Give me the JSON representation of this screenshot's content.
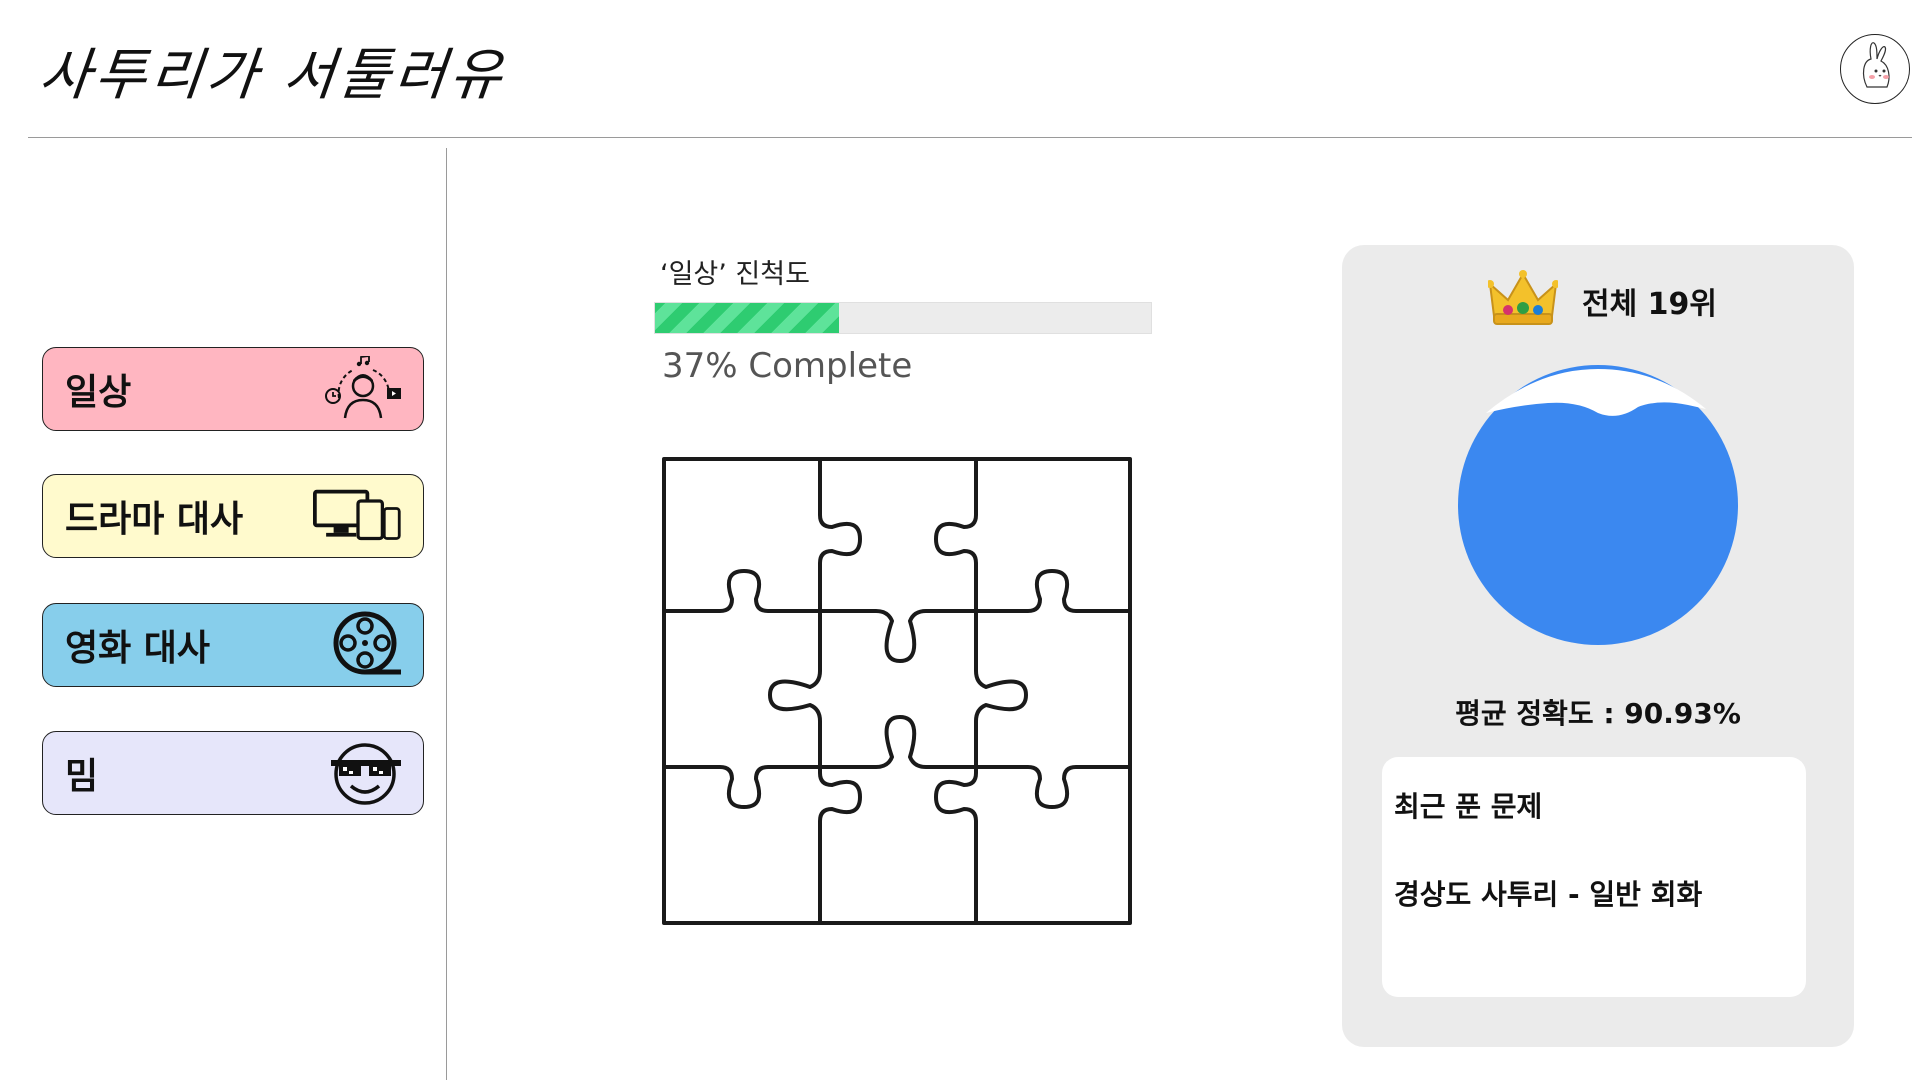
{
  "header": {
    "app_title": "사투리가 서툴러유",
    "avatar_icon": "rabbit-avatar-icon"
  },
  "sidebar": {
    "items": [
      {
        "label": "일상",
        "icon": "daily-life-icon",
        "color": "#ffb6c1"
      },
      {
        "label": "드라마 대사",
        "icon": "devices-icon",
        "color": "#fffacd"
      },
      {
        "label": "영화 대사",
        "icon": "film-reel-icon",
        "color": "#87ceeb"
      },
      {
        "label": "밈",
        "icon": "sunglasses-smiley-icon",
        "color": "#e6e6fa"
      }
    ]
  },
  "progress": {
    "title": "‘일상’ 진척도",
    "percent": 37,
    "label": "37% Complete",
    "fill_color": "#2ecc71"
  },
  "puzzle": {
    "icon": "puzzle-icon"
  },
  "stats": {
    "rank_icon": "crown-icon",
    "rank_text": "전체 19위",
    "accuracy_text": "평균 정확도 : 90.93%",
    "water_color": "#3b88f0",
    "recent": {
      "title": "최근 푼 문제",
      "item": "경상도 사투리 - 일반 회화"
    }
  }
}
